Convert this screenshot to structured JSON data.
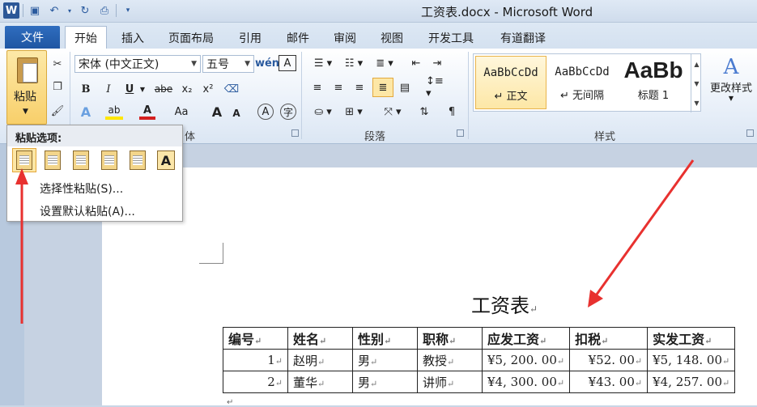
{
  "window": {
    "title": "工资表.docx - Microsoft Word"
  },
  "quick_access": {
    "logo": "W"
  },
  "tabs": {
    "file": "文件",
    "items": [
      "开始",
      "插入",
      "页面布局",
      "引用",
      "邮件",
      "审阅",
      "视图",
      "开发工具",
      "有道翻译"
    ]
  },
  "ribbon": {
    "paste_label": "粘贴",
    "font_name": "宋体 (中文正文)",
    "font_size": "五号",
    "bold": "B",
    "italic": "I",
    "underline": "U",
    "strike": "abe",
    "subscript": "x₂",
    "superscript": "x²",
    "font_grow": "A",
    "font_shrink": "A",
    "change_case": "Aa",
    "font_group_label": "体",
    "paragraph_group_label": "段落",
    "styles_group_label": "样式",
    "styles": [
      {
        "sample": "AaBbCcDd",
        "name": "正文"
      },
      {
        "sample": "AaBbCcDd",
        "name": "无间隔"
      },
      {
        "sample": "AaBb",
        "name": "标题 1"
      }
    ],
    "change_styles": "更改样式"
  },
  "paste_menu": {
    "title": "粘贴选项:",
    "item1": "选择性粘贴(S)...",
    "item2": "设置默认粘贴(A)..."
  },
  "document": {
    "title": "工资表",
    "headers": [
      "编号",
      "姓名",
      "性别",
      "职称",
      "应发工资",
      "扣税",
      "实发工资"
    ],
    "rows": [
      [
        "1",
        "赵明",
        "男",
        "教授",
        "¥5, 200. 00",
        "¥52. 00",
        "¥5, 148. 00"
      ],
      [
        "2",
        "董华",
        "男",
        "讲师",
        "¥4, 300. 00",
        "¥43. 00",
        "¥4, 257. 00"
      ]
    ]
  },
  "colors": {
    "accent": "#2b5797",
    "highlight": "#fde7a6",
    "annotation": "#e8312f"
  }
}
